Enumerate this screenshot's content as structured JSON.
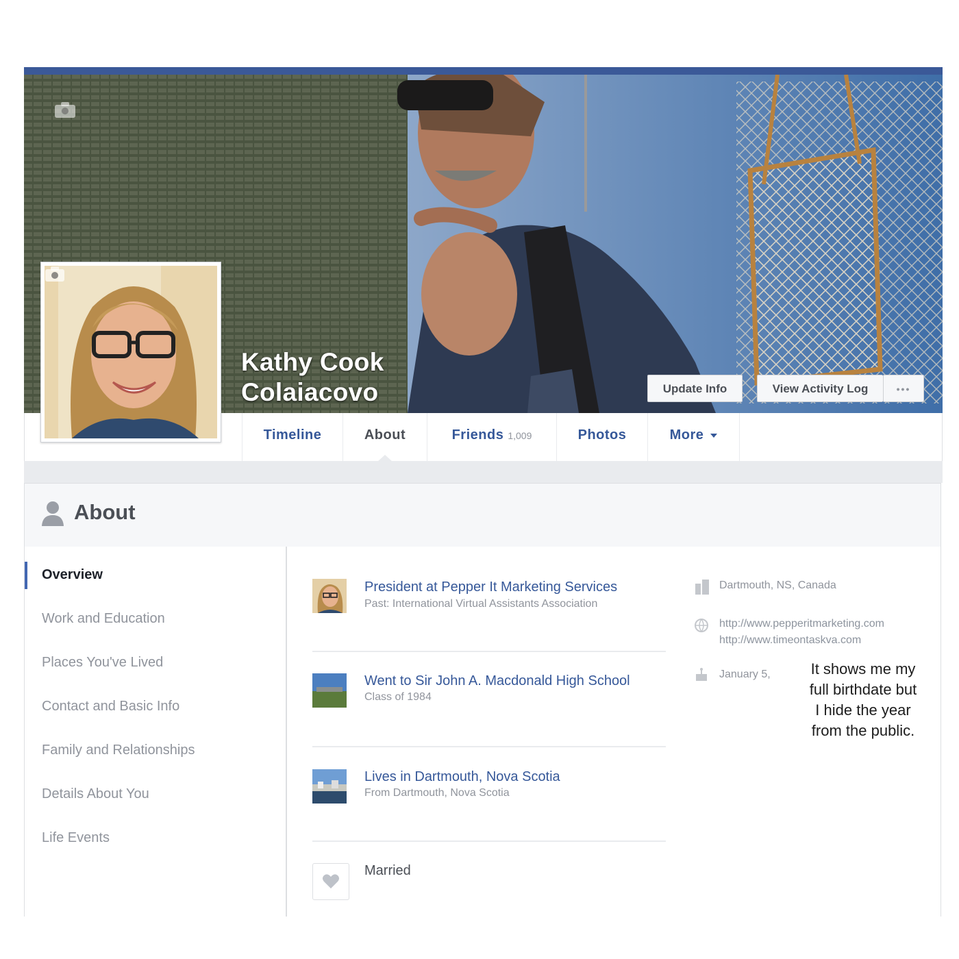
{
  "profile": {
    "name_line1": "Kathy Cook",
    "name_line2": "Colaiacovo"
  },
  "actions": {
    "update_info": "Update Info",
    "view_activity_log": "View Activity Log",
    "more_dots": "•••"
  },
  "tabs": [
    {
      "label": "Timeline"
    },
    {
      "label": "About"
    },
    {
      "label": "Friends",
      "count": "1,009"
    },
    {
      "label": "Photos"
    },
    {
      "label": "More"
    }
  ],
  "about": {
    "title": "About",
    "nav": [
      "Overview",
      "Work and Education",
      "Places You've Lived",
      "Contact and Basic Info",
      "Family and Relationships",
      "Details About You",
      "Life Events"
    ],
    "entries": [
      {
        "title": "President at Pepper It Marketing Services",
        "sub": "Past: International Virtual Assistants Association"
      },
      {
        "title": "Went to Sir John A. Macdonald High School",
        "sub": "Class of 1984"
      },
      {
        "title": "Lives in Dartmouth, Nova Scotia",
        "sub": "From Dartmouth, Nova Scotia"
      },
      {
        "title": "Married",
        "sub": ""
      }
    ],
    "contact": {
      "location": "Dartmouth, NS, Canada",
      "website1": "http://www.pepperitmarketing.com",
      "website2": "http://www.timeontaskva.com",
      "birthday": "January 5,"
    }
  },
  "annotation": {
    "line1": "It shows me my",
    "line2": "full birthdate but",
    "line3": "I hide the year",
    "line4": "from the public."
  },
  "colors": {
    "facebook_blue": "#3b5998",
    "link_blue": "#365899",
    "nav_accent": "#4267b2"
  }
}
